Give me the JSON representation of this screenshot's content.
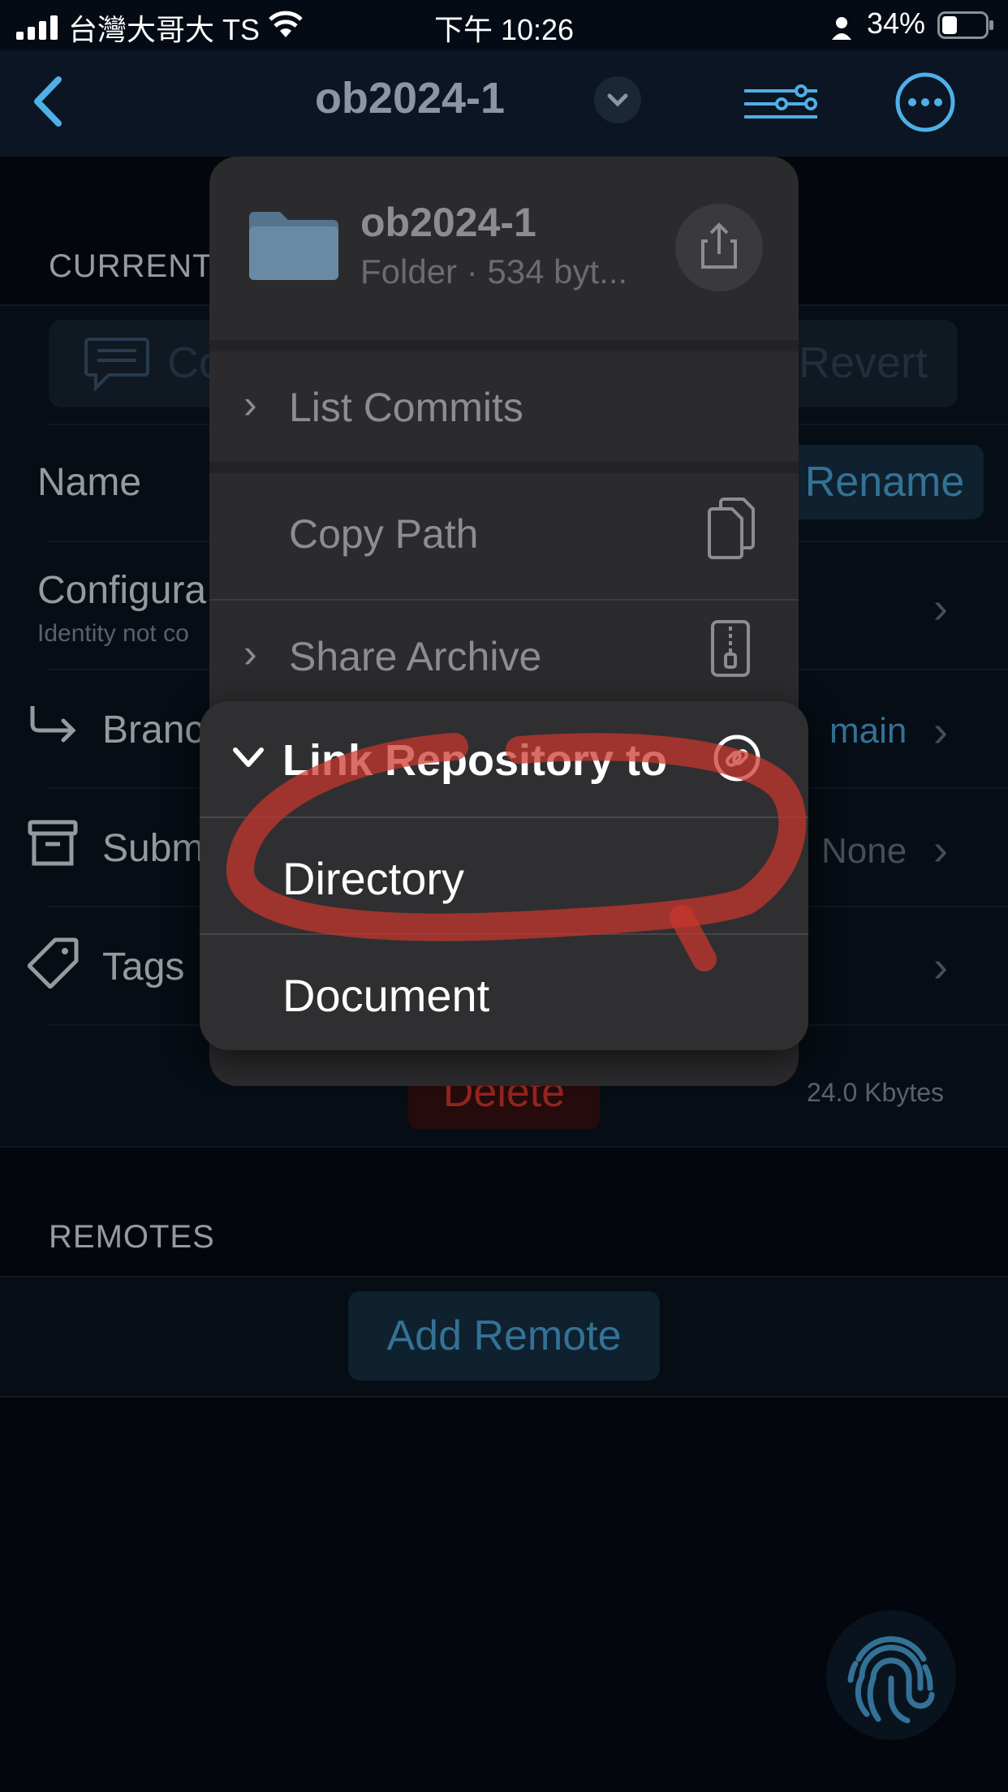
{
  "status_bar": {
    "carrier": "台灣大哥大 TS",
    "time": "下午 10:26",
    "battery": "34%"
  },
  "navbar": {
    "title": "ob2024-1"
  },
  "current_section": {
    "heading": "CURRENT",
    "commit_placeholder": "Co",
    "revert_label": "Revert",
    "name_label": "Name",
    "rename_label": "Rename",
    "config_label": "Configura",
    "config_sub": "Identity not co",
    "branch_label": "Branc",
    "branch_value": "main",
    "submodules_label": "Subm",
    "submodules_value": "None",
    "tags_label": "Tags",
    "delete_label": "Delete",
    "size_value": "24.0 Kbytes"
  },
  "remotes_section": {
    "heading": "REMOTES",
    "add_remote_label": "Add Remote"
  },
  "context_menu": {
    "folder_name": "ob2024-1",
    "folder_meta": "Folder · 534 byt...",
    "items": [
      {
        "label": "List Commits"
      },
      {
        "label": "Copy Path"
      },
      {
        "label": "Share Archive"
      }
    ],
    "submenu": {
      "title": "Link Repository to",
      "options": [
        {
          "label": "Directory"
        },
        {
          "label": "Document"
        }
      ]
    }
  },
  "colors": {
    "accent": "#4fb0e6",
    "annotation": "#c9362c",
    "delete": "#e0392f"
  }
}
